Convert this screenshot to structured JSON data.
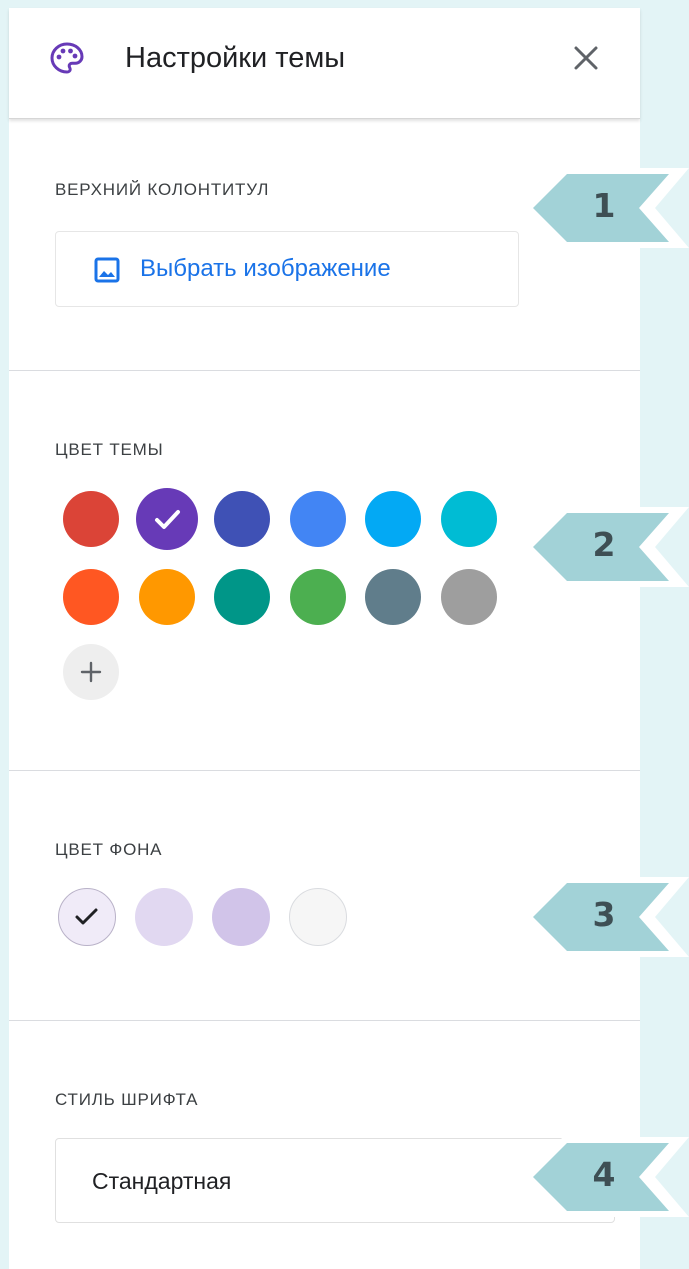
{
  "header": {
    "title": "Настройки темы",
    "icon": "palette-icon",
    "close_icon": "close-icon"
  },
  "sections": {
    "header_image": {
      "label": "ВЕРХНИЙ КОЛОНТИТУЛ",
      "button_label": "Выбрать изображение",
      "button_icon": "image-icon"
    },
    "theme_color": {
      "label": "ЦВЕТ ТЕМЫ",
      "colors": [
        "#db4437",
        "#673ab7",
        "#3f51b5",
        "#4285f4",
        "#03a9f4",
        "#00bcd4",
        "#ff5722",
        "#ff9800",
        "#009688",
        "#4caf50",
        "#607d8b",
        "#9e9e9e"
      ],
      "selected_index": 1,
      "add_icon": "plus-icon"
    },
    "background_color": {
      "label": "ЦВЕТ ФОНА",
      "colors": [
        "#f0ebf8",
        "#e1d8f1",
        "#d1c4e9",
        "#f6f6f6"
      ],
      "selected_index": 0
    },
    "font_style": {
      "label": "СТИЛЬ ШРИФТА",
      "value": "Стандартная"
    }
  },
  "callouts": [
    "1",
    "2",
    "3",
    "4"
  ],
  "colors": {
    "page_background": "#e3f4f6",
    "accent": "#1a73e8",
    "callout_fill": "#a2d2d7",
    "callout_text": "#3e4f54"
  }
}
